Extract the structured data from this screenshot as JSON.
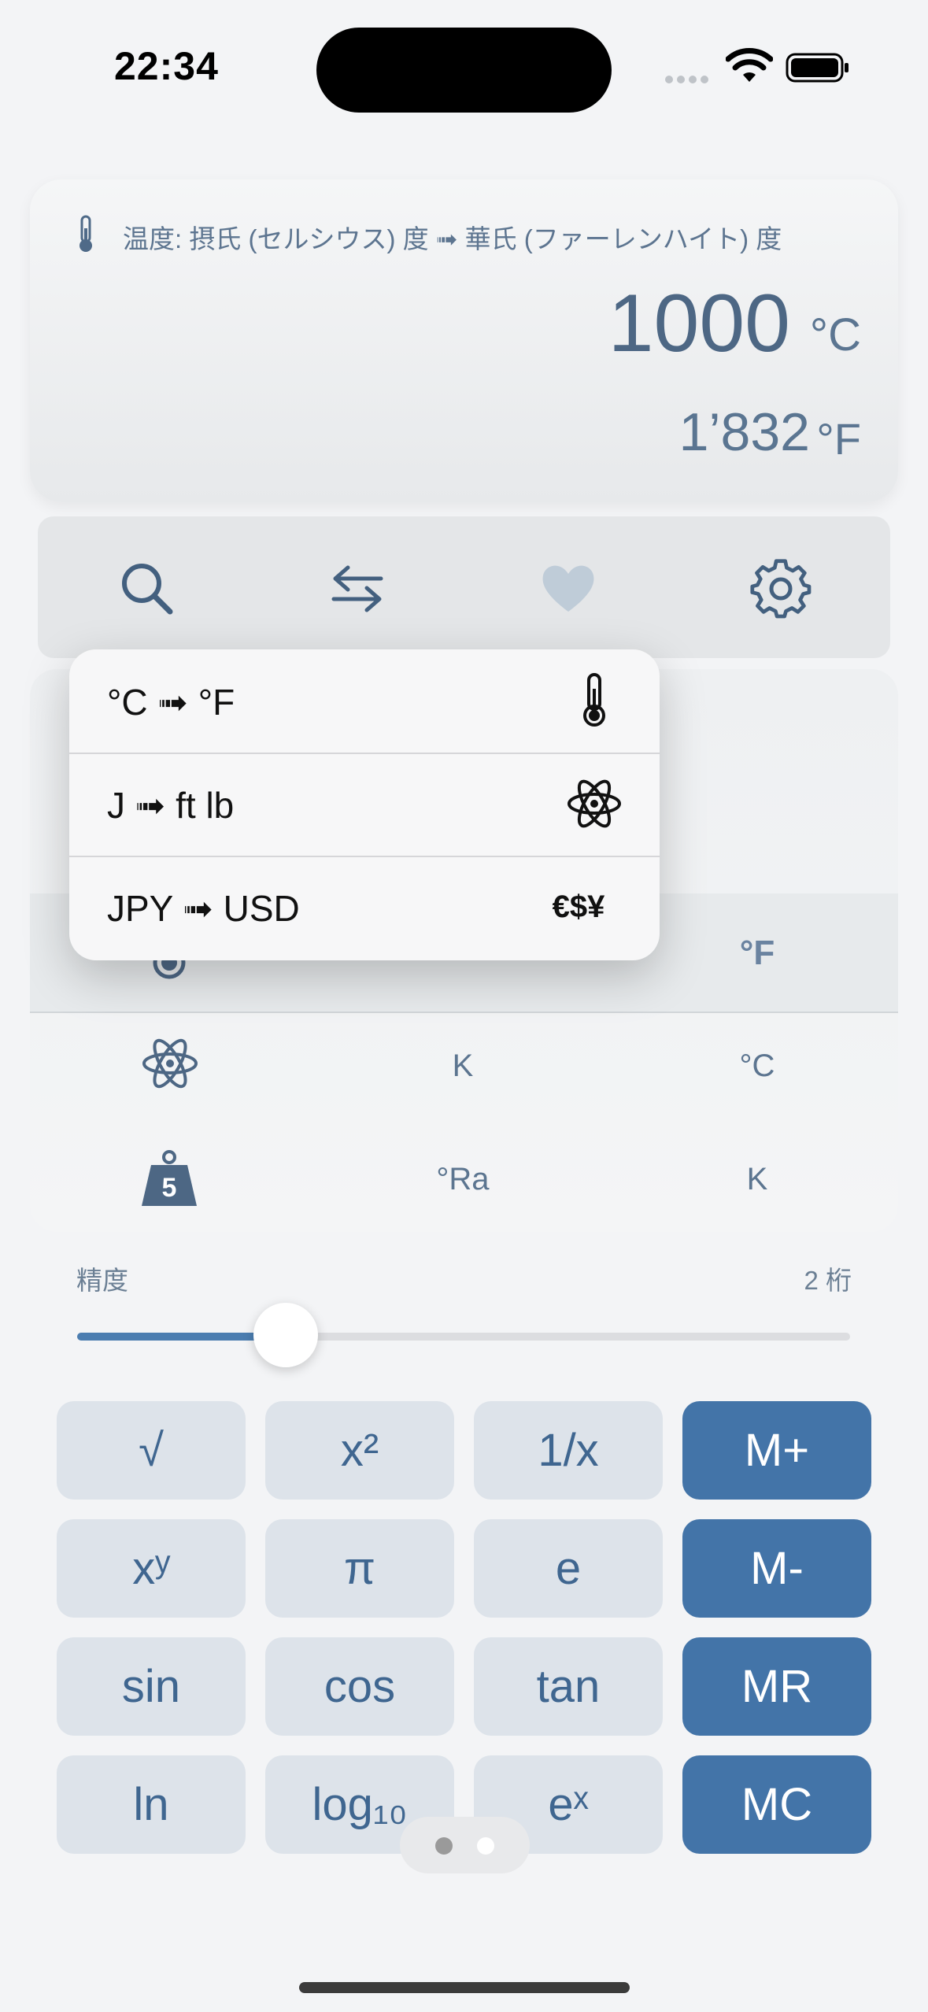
{
  "status_bar": {
    "time": "22:34"
  },
  "conversion": {
    "title": "温度: 摂氏 (セルシウス) 度 ➟ 華氏 (ファーレンハイト) 度",
    "input_value": "1000",
    "input_unit": "°C",
    "output_value": "1’832",
    "output_unit": "°F"
  },
  "toolbar": {
    "items": [
      {
        "icon": "search-icon"
      },
      {
        "icon": "swap-icon"
      },
      {
        "icon": "heart-icon"
      },
      {
        "icon": "gear-icon"
      }
    ]
  },
  "menu": {
    "items": [
      {
        "label": "°C ➟ °F",
        "icon": "thermometer-icon",
        "icon_text": ""
      },
      {
        "label": "J ➟ ft lb",
        "icon": "atom-icon",
        "icon_text": ""
      },
      {
        "label": "JPY ➟ USD",
        "icon": "currency-icon",
        "icon_text": "€$¥"
      }
    ]
  },
  "unit_rows": [
    {
      "icon": "thermometer-icon",
      "from": "",
      "to": "°F"
    },
    {
      "icon": "atom-icon",
      "from": "K",
      "to": "°C"
    },
    {
      "icon": "weight-icon",
      "icon_text": "5",
      "from": "°Ra",
      "to": "K"
    }
  ],
  "precision": {
    "label": "精度",
    "value": "2 桁",
    "level": 0.27
  },
  "keypad": {
    "rows": [
      [
        "√",
        "x²",
        "1/x",
        "M+"
      ],
      [
        "xʸ",
        "π",
        "e",
        "M-"
      ],
      [
        "sin",
        "cos",
        "tan",
        "MR"
      ],
      [
        "ln",
        "log₁₀",
        "eˣ",
        "MC"
      ]
    ]
  },
  "pager": {
    "pages": 2,
    "current": 2
  },
  "colors": {
    "accent": "#4374a8",
    "key_bg": "#dde3ea",
    "key_text": "#3f6690"
  }
}
